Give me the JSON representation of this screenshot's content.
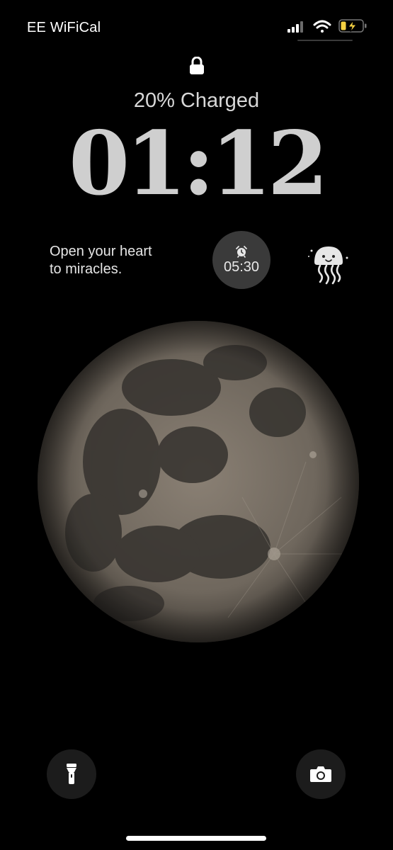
{
  "status_bar": {
    "carrier": "EE WiFiCal",
    "icons": [
      "signal-icon",
      "wifi-icon",
      "battery-charging-icon"
    ],
    "battery_color": "#f5d142"
  },
  "lock_screen": {
    "lock_icon": "lock-icon",
    "charge_status": "20% Charged",
    "time": "01:12"
  },
  "widgets": {
    "quote": {
      "line1": "Open your heart",
      "line2": "to miracles."
    },
    "alarm": {
      "icon": "alarm-clock-icon",
      "time": "05:30"
    },
    "mascot_icon": "jellyfish-icon"
  },
  "wallpaper": "full-moon",
  "quick_actions": {
    "flashlight_icon": "flashlight-icon",
    "camera_icon": "camera-icon"
  }
}
